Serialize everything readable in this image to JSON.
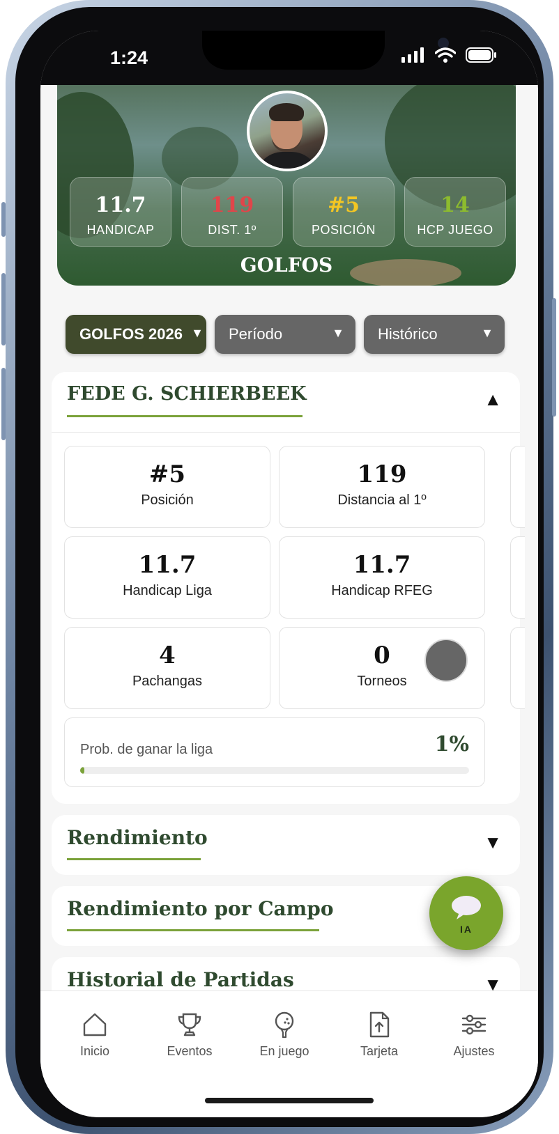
{
  "status": {
    "time": "1:24"
  },
  "hero": {
    "title": "GOLFOS",
    "stats": [
      {
        "value": "11.7",
        "label": "HANDICAP",
        "color": "#ffffff"
      },
      {
        "value": "119",
        "label": "DIST. 1º",
        "color": "#e0454a"
      },
      {
        "value": "#5",
        "label": "POSICIÓN",
        "color": "#f3c623"
      },
      {
        "value": "14",
        "label": "HCP JUEGO",
        "color": "#8dbb2e"
      }
    ]
  },
  "filters": [
    {
      "label": "GOLFOS 2026",
      "color": "#404a2c"
    },
    {
      "label": "Período",
      "color": "#666666"
    },
    {
      "label": "Histórico",
      "color": "#666666"
    }
  ],
  "player": {
    "name": "FEDE G. SCHIERBEEK",
    "metrics": [
      {
        "value": "#5",
        "label": "Posición"
      },
      {
        "value": "119",
        "label": "Distancia al 1º"
      },
      {
        "value": "11.7",
        "label": "Handicap Liga"
      },
      {
        "value": "11.7",
        "label": "Handicap RFEG"
      },
      {
        "value": "4",
        "label": "Pachangas"
      },
      {
        "value": "0",
        "label": "Torneos"
      }
    ],
    "prob_label": "Prob. de ganar la liga",
    "prob_value": "1%",
    "prob_fraction": 0.01
  },
  "sections": [
    {
      "title": "Rendimiento"
    },
    {
      "title": "Rendimiento por Campo"
    },
    {
      "title": "Historial de Partidas"
    }
  ],
  "fab": {
    "label": "IA"
  },
  "tabs": [
    {
      "label": "Inicio",
      "icon": "home-icon"
    },
    {
      "label": "Eventos",
      "icon": "trophy-icon"
    },
    {
      "label": "En juego",
      "icon": "golf-ball-icon"
    },
    {
      "label": "Tarjeta",
      "icon": "upload-card-icon"
    },
    {
      "label": "Ajustes",
      "icon": "sliders-icon"
    }
  ],
  "colors": {
    "accent": "#7ba23a",
    "title": "#2f4a2f",
    "fab": "#7aa52c"
  }
}
